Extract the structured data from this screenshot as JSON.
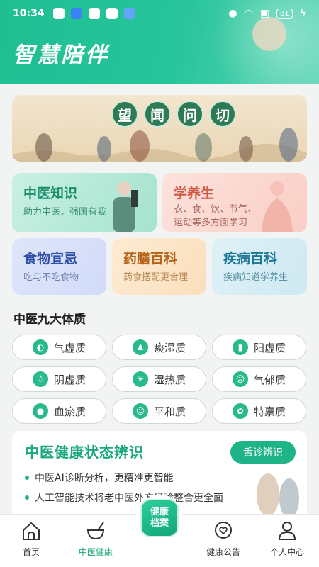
{
  "status_bar": {
    "time": "10:34",
    "battery": "81"
  },
  "app": {
    "title": "智慧陪伴"
  },
  "banner": {
    "chars": [
      "望",
      "闻",
      "问",
      "切"
    ]
  },
  "cards": {
    "tcm": {
      "title": "中医知识",
      "subtitle": "助力中医，强国有我"
    },
    "health": {
      "title": "学养生",
      "subtitle_line1": "衣、食、饮、节气、",
      "subtitle_line2": "运动等多方面学习"
    },
    "food": {
      "title": "食物宜忌",
      "subtitle": "吃与不吃食物"
    },
    "medicine": {
      "title": "药膳百科",
      "subtitle": "药食搭配更合理"
    },
    "disease": {
      "title": "疾病百科",
      "subtitle": "疾病知道学养生"
    }
  },
  "constitution": {
    "title": "中医九大体质",
    "items": [
      {
        "label": "气虚质",
        "icon": "qi-icon"
      },
      {
        "label": "痰湿质",
        "icon": "person-icon"
      },
      {
        "label": "阳虚质",
        "icon": "bracket-icon"
      },
      {
        "label": "阴虚质",
        "icon": "figure-icon"
      },
      {
        "label": "湿热质",
        "icon": "sun-icon"
      },
      {
        "label": "气郁质",
        "icon": "face-icon"
      },
      {
        "label": "血瘀质",
        "icon": "drop-icon"
      },
      {
        "label": "平和质",
        "icon": "smile-icon"
      },
      {
        "label": "特禀质",
        "icon": "flower-icon"
      }
    ]
  },
  "diagnosis": {
    "title": "中医健康状态辨识",
    "button": "舌诊辨识",
    "points": [
      "中医AI诊断分析，更精准更智能",
      "人工智能技术将老中医外方经验整合更全面"
    ]
  },
  "nav": {
    "home": "首页",
    "tcm_health": "中医健康",
    "center_line1": "健康",
    "center_line2": "档案",
    "notice": "健康公告",
    "profile": "个人中心"
  },
  "colors": {
    "brand": "#1fb488",
    "header": "#27c49b"
  }
}
